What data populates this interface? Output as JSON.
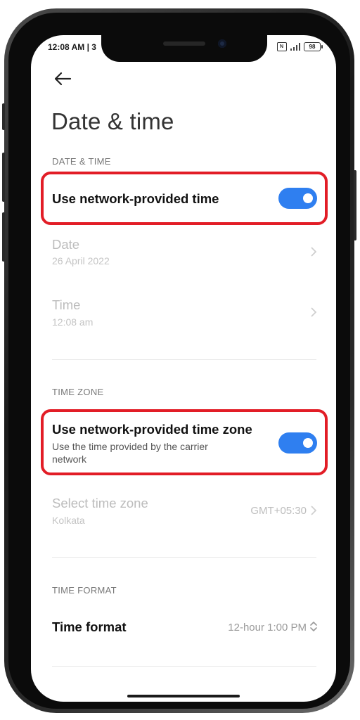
{
  "status_bar": {
    "time": "12:08 AM | 3",
    "sim_label": "N",
    "battery": "98"
  },
  "header": {
    "back_icon": "arrow-left-icon",
    "title": "Date & time"
  },
  "sections": {
    "date_time": {
      "header": "DATE & TIME",
      "network_time": {
        "label": "Use network-provided time",
        "enabled": true
      },
      "date": {
        "label": "Date",
        "value": "26 April 2022"
      },
      "time": {
        "label": "Time",
        "value": "12:08 am"
      }
    },
    "time_zone": {
      "header": "TIME ZONE",
      "network_zone": {
        "label": "Use network-provided time zone",
        "description": "Use the time provided by the carrier\nnetwork",
        "enabled": true
      },
      "select_zone": {
        "label": "Select time zone",
        "sub": "Kolkata",
        "value": "GMT+05:30"
      }
    },
    "time_format": {
      "header": "TIME FORMAT",
      "format": {
        "label": "Time format",
        "value": "12-hour 1:00 PM"
      }
    }
  },
  "colors": {
    "toggle_on": "#2f7ff0",
    "highlight": "#e21d26"
  }
}
